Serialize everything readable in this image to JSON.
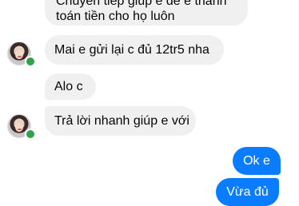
{
  "messages": [
    {
      "direction": "incoming",
      "lines": [
        "Chuyển tiếp giúp e để e thanh",
        "toán tiền cho họ luôn"
      ]
    },
    {
      "direction": "incoming",
      "text": "Mai e gửi lại c đủ 12tr5 nha"
    },
    {
      "direction": "incoming",
      "text": "Alo c"
    },
    {
      "direction": "incoming",
      "text": "Trả lời nhanh giúp e với"
    },
    {
      "direction": "outgoing",
      "text": "Ok e"
    },
    {
      "direction": "outgoing",
      "text": "Vừa đủ"
    }
  ],
  "contact": {
    "avatar_icon": "contact-avatar-icon",
    "online": true
  },
  "colors": {
    "incoming_bubble": "#f0f0f0",
    "outgoing_bubble": "#0a7cff",
    "online_dot": "#31a24c"
  }
}
